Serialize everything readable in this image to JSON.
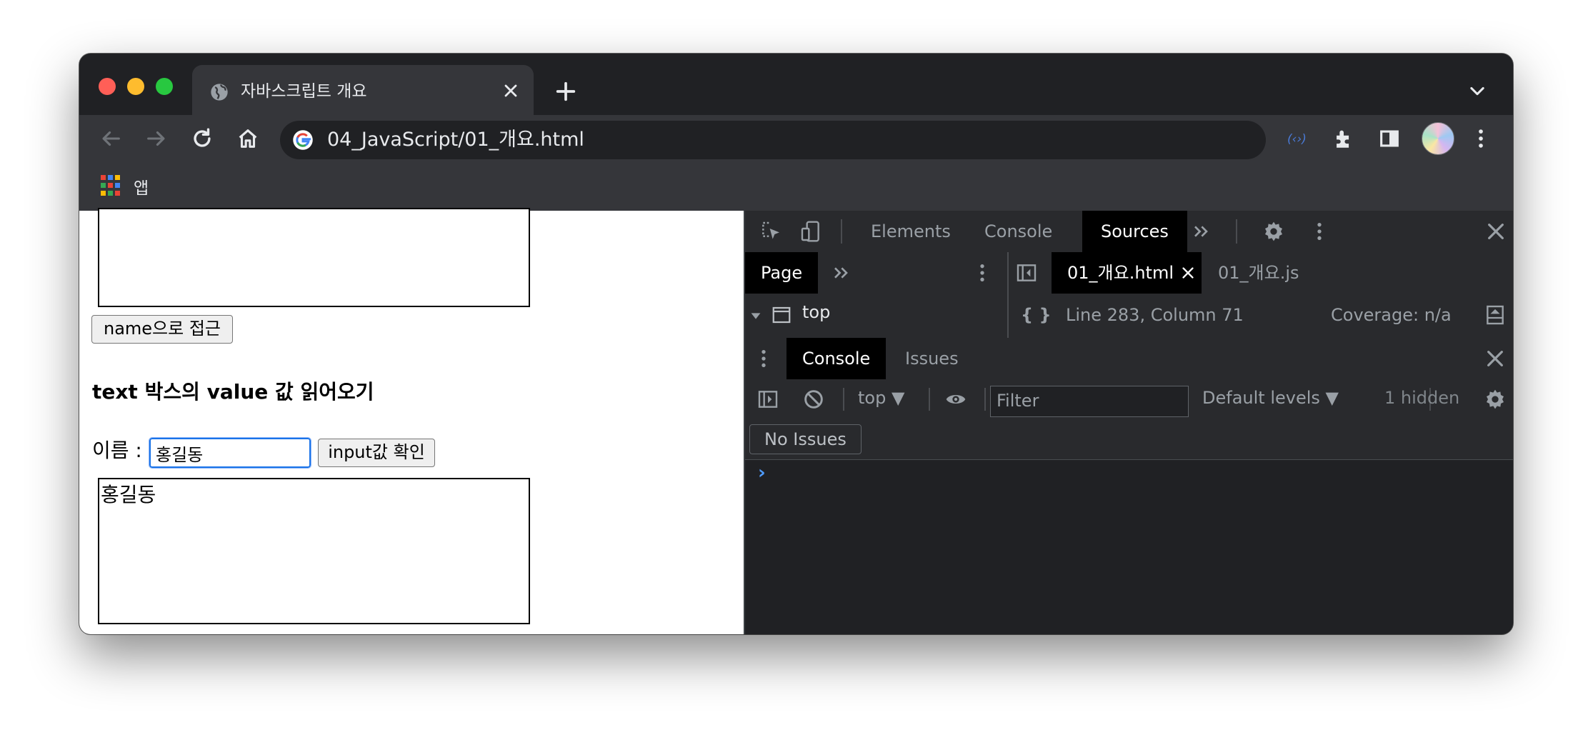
{
  "browser": {
    "tab_title": "자바스크립트 개요",
    "url": "04_JavaScript/01_개요.html",
    "bookmark_apps_label": "앱"
  },
  "page": {
    "button_access_by_name": "name으로 접근",
    "heading_read_value": "text 박스의 value 값 읽어오기",
    "name_label": "이름 :",
    "name_input_value": "홍길동",
    "button_check_input": "input값 확인",
    "result_text": "홍길동"
  },
  "devtools": {
    "tabs": [
      "Elements",
      "Console",
      "Sources"
    ],
    "active_tab": "Sources",
    "navigator_tab": "Page",
    "file_tabs": [
      "01_개요.html",
      "01_개요.js"
    ],
    "tree_root": "top",
    "cursor_position": "Line 283, Column 71",
    "coverage": "Coverage: n/a",
    "drawer_tabs": [
      "Console",
      "Issues"
    ],
    "context_selector": "top",
    "filter_placeholder": "Filter",
    "levels": "Default levels",
    "hidden_count": "1 hidden",
    "no_issues": "No Issues"
  },
  "colors": {
    "window_bg": "#202124",
    "toolbar_bg": "#35363a",
    "focus_ring": "#1a73e8",
    "console_prompt": "#4f9cff"
  }
}
